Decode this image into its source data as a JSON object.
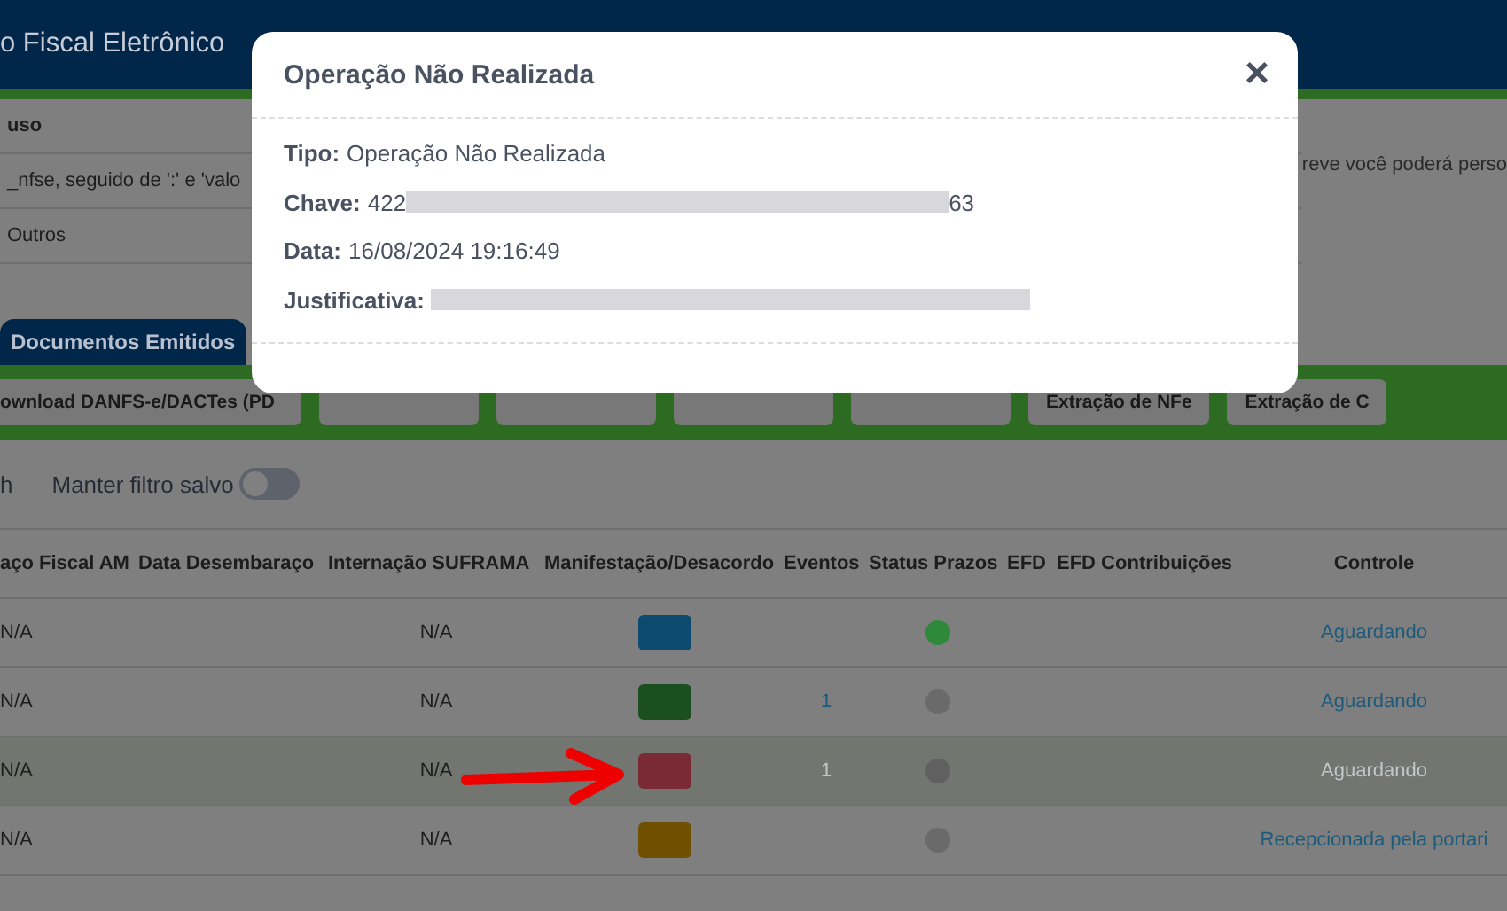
{
  "header": {
    "title": "o Fiscal Eletrônico"
  },
  "info_panel": {
    "rows": [
      {
        "kind": "heading",
        "text": "uso"
      },
      {
        "kind": "text",
        "text": "_nfse, seguido de ':' e 'valo"
      },
      {
        "kind": "text",
        "text": "Outros"
      }
    ],
    "side_text": "reve você poderá perso"
  },
  "tabs": [
    {
      "label": "Documentos Emitidos",
      "selected": true
    }
  ],
  "toolbar": {
    "buttons": [
      {
        "kind": "label",
        "label": "ownload DANFS-e/DACTes (PD"
      },
      {
        "kind": "covered"
      },
      {
        "kind": "covered"
      },
      {
        "kind": "covered"
      },
      {
        "kind": "covered"
      },
      {
        "kind": "label",
        "label": "Extração de NFe"
      },
      {
        "kind": "label",
        "label": "Extração de C"
      }
    ]
  },
  "filter": {
    "left_text": "h",
    "toggle": {
      "label": "Manter filtro salvo",
      "on": false
    }
  },
  "table": {
    "columns": [
      "aço Fiscal AM",
      "Data Desembaraço",
      "Internação SUFRAMA",
      "Manifestação/Desacordo",
      "Eventos",
      "Status Prazos",
      "EFD",
      "EFD Contribuições",
      "Controle"
    ],
    "rows": [
      {
        "selected": false,
        "column_1": "N/A",
        "suframa": "N/A",
        "manifestation": {
          "color": "#0c4a70"
        },
        "status": {
          "color": "#2e8a3a"
        },
        "control": "Aguardando"
      },
      {
        "selected": false,
        "column_1": "N/A",
        "suframa": "N/A",
        "manifestation": {
          "color": "#1b4f1f"
        },
        "events": "1",
        "status": {
          "color": "#6a6a6a"
        },
        "control": "Aguardando"
      },
      {
        "selected": true,
        "column_1": "N/A",
        "suframa": "N/A",
        "manifestation": {
          "color": "#7a2a35"
        },
        "events": "1",
        "status": {
          "color": "#606060"
        },
        "control": "Aguardando"
      },
      {
        "selected": false,
        "column_1": "N/A",
        "suframa": "N/A",
        "manifestation": {
          "color": "#6f5000"
        },
        "status": {
          "color": "#6a6a6a"
        },
        "control": "Recepcionada pela portari"
      }
    ]
  },
  "modal": {
    "title": "Operação Não Realizada",
    "close": "×",
    "fields": [
      {
        "label": "Tipo:",
        "value": "Operação Não Realizada",
        "redacted": false
      },
      {
        "label": "Chave:",
        "value": "422",
        "redacted": true,
        "value_end": "63"
      },
      {
        "label": "Data:",
        "value": "16/08/2024 19:16:49",
        "redacted": false
      },
      {
        "label": "Justificativa:",
        "redacted": true
      }
    ]
  }
}
